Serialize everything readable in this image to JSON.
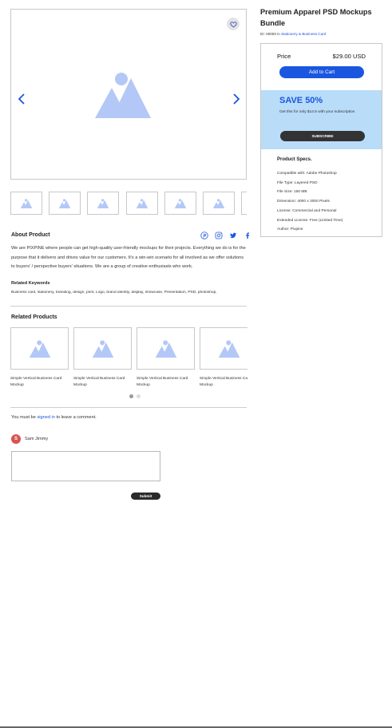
{
  "product": {
    "title": "Premium Apparel PSD Mockups Bundle",
    "id_text": "ID: 00000 in",
    "category": "Stationery & Business Card"
  },
  "gallery": {
    "thumbnail_count": 7
  },
  "purchase": {
    "price_label": "Price",
    "price_value": "$29.00 USD",
    "add_to_cart_label": "Add to Cart"
  },
  "subscription": {
    "title": "SAVE 50%",
    "text": "Get this for only $14.5 with your subscription",
    "button_label": "SUBSCRIBE"
  },
  "specs": {
    "title": "Product Specs.",
    "items": [
      "Compatible with: Adobe Photoshop",
      "File Type: Layered PSD",
      "File Size: 150 MB",
      "Dimension: 4000 x 3000 Pixels",
      "License: Commercial and Personal",
      "Extended License: Free (Limited Time)",
      "Author: Pixpine"
    ]
  },
  "about": {
    "title": "About Product",
    "text": "We are PIXPINE where people can get high-quality user-friendly mockups for their projects. Everything we do is for the purpose that it delivers and drives value for our customers. It's a win-win scenario for all involved as we offer solutions to buyers' / perspective buyers' situations. We are a group of creative enthusiasts who work.",
    "keywords_title": "Related Keywords",
    "keywords": "Business card, stationery, branding, design, print, Logo, brand identity, display, showcase, Presentation, PSD, photoshop,"
  },
  "social_icons": [
    "pinterest-icon",
    "instagram-icon",
    "twitter-icon",
    "facebook-icon"
  ],
  "related": {
    "title": "Related Products",
    "items": [
      {
        "caption": "Simple Vertical Business Card Mockup"
      },
      {
        "caption": "Simple Vertical Business Card Mockup"
      },
      {
        "caption": "Simple Vertical Business Card Mockup"
      },
      {
        "caption": "Simple Vertical Business Card Mockup"
      }
    ]
  },
  "comments": {
    "note_prefix": "You must be",
    "note_link": "signed in",
    "note_suffix": "to leave a comment.",
    "user_initial": "S",
    "user_name": "Sam Jimmy",
    "submit_label": "Submit"
  },
  "colors": {
    "accent": "#1a56e0",
    "subscription_bg": "#b9dcf9",
    "placeholder": "#b3c8f7",
    "avatar": "#d9534f"
  }
}
